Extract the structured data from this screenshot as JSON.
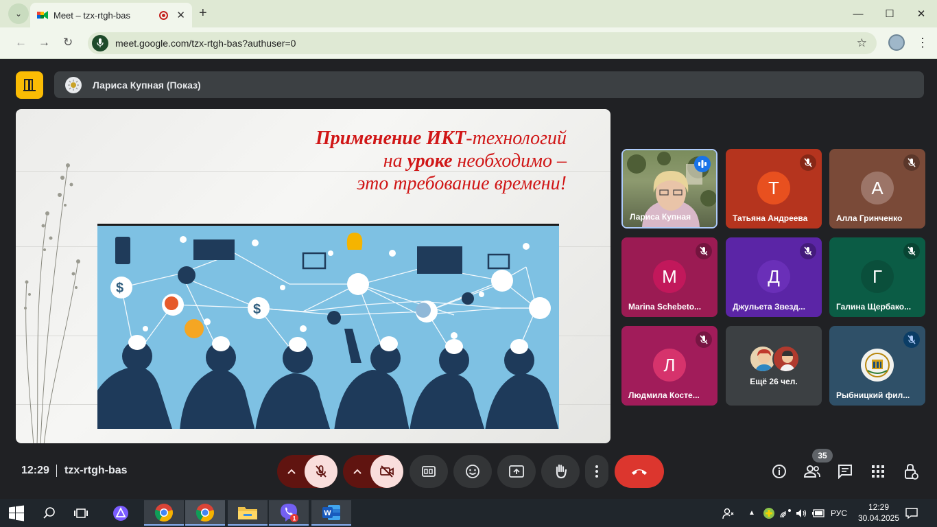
{
  "browser": {
    "tab_title": "Meet – tzx-rtgh-bas",
    "url": "meet.google.com/tzx-rtgh-bas?authuser=0",
    "icons": [
      "tab-search-icon",
      "meet-favicon",
      "recording-icon",
      "close-icon",
      "new-tab-icon",
      "minimize-icon",
      "maximize-icon",
      "window-close-icon",
      "back-icon",
      "forward-icon",
      "reload-icon",
      "voice-search-icon",
      "bookmark-star-icon",
      "profile-icon",
      "browser-menu-icon"
    ]
  },
  "meet": {
    "presenter_label": "Лариса Купная (Показ)",
    "slide": {
      "line1_strong": "Применение ИКТ",
      "line1_rest": "-технологий",
      "line2_pre": "на ",
      "line2_strong": "уроке",
      "line2_rest": " необходимо –",
      "line3": "это требование времени!"
    },
    "participants": [
      {
        "name": "Лариса Купная",
        "initial": "",
        "bg": "#6c7a5a",
        "state": "speaking"
      },
      {
        "name": "Татьяна Андреева",
        "initial": "Т",
        "bg": "#b5341e",
        "avatar": "#e8501f",
        "state": "muted"
      },
      {
        "name": "Алла Гринченко",
        "initial": "А",
        "bg": "#7a4a38",
        "avatar": "#9c7568",
        "state": "muted"
      },
      {
        "name": "Marina Schebeto...",
        "initial": "M",
        "bg": "#9b1b53",
        "avatar": "#c2185b",
        "state": "muted"
      },
      {
        "name": "Джульета Звезд...",
        "initial": "Д",
        "bg": "#5b25a6",
        "avatar": "#6a2fb8",
        "state": "muted"
      },
      {
        "name": "Галина Щербако...",
        "initial": "Г",
        "bg": "#0b5c45",
        "avatar": "#0a4f3b",
        "state": "muted"
      },
      {
        "name": "Людмила Косте...",
        "initial": "Л",
        "bg": "#a11c5a",
        "avatar": "#d6336c",
        "state": "muted"
      },
      {
        "name": "Ещё 26 чел.",
        "initial": "",
        "bg": "#3c4043",
        "state": "more"
      },
      {
        "name": "Рыбницкий фил...",
        "initial": "",
        "bg": "#2f5068",
        "state": "muted-blue"
      }
    ],
    "time": "12:29",
    "meeting_code": "tzx-rtgh-bas",
    "participant_count": "35",
    "controls": [
      "mic-options-button",
      "mic-toggle-button",
      "camera-options-button",
      "camera-toggle-button",
      "captions-button",
      "emoji-button",
      "present-button",
      "raise-hand-button",
      "more-options-button",
      "leave-call-button"
    ],
    "right_controls": [
      "meeting-info-button",
      "people-button",
      "chat-button",
      "activities-button",
      "host-controls-button"
    ]
  },
  "taskbar": {
    "lang": "РУС",
    "clock_time": "12:29",
    "clock_date": "30.04.2025",
    "viber_badge": "1"
  },
  "colors": {
    "meet_bg": "#202124",
    "leave_red": "#ea4335",
    "muted_red": "#f9dedc",
    "dark_red": "#601410",
    "slide_red": "#d01616"
  }
}
